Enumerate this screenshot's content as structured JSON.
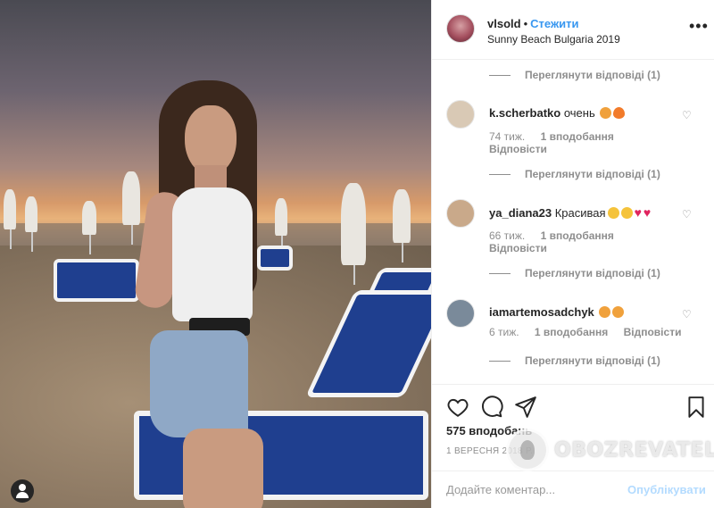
{
  "post": {
    "username": "vlsold",
    "separator": "•",
    "follow_label": "Стежити",
    "location": "Sunny Beach Bulgaria 2019",
    "more_label": "•••"
  },
  "comments": {
    "view_replies_label": "Переглянути відповіді (1)",
    "items": [
      {
        "username": "k.scherbatko",
        "text": "очень",
        "emojis": [
          "cat",
          "fire"
        ],
        "time": "74 тиж.",
        "likes": "1 вподобання",
        "reply_label": "Відповісти",
        "avatar_color": "#d9c9b5"
      },
      {
        "username": "ya_diana23",
        "text": "Красивая",
        "emojis": [
          "smile",
          "smile",
          "heart",
          "heart"
        ],
        "time": "66 тиж.",
        "likes": "1 вподобання",
        "reply_label": "Відповісти",
        "avatar_color": "#c9a98a"
      },
      {
        "username": "iamartemosadchyk",
        "text": "",
        "emojis": [
          "cat",
          "cat"
        ],
        "time": "6 тиж.",
        "likes": "1 вподобання",
        "reply_label": "Відповісти",
        "avatar_color": "#7a8a9a"
      }
    ]
  },
  "actions": {
    "likes_count": "575 вподобань",
    "date": "1 ВЕРЕСНЯ 2018 Р."
  },
  "comment_bar": {
    "placeholder": "Додайте коментар...",
    "publish_label": "Опублікувати"
  },
  "watermark": {
    "text": "OBOZREVATEL"
  },
  "icons": {
    "heart": "heart-icon",
    "comment": "comment-icon",
    "share": "share-icon",
    "bookmark": "bookmark-icon",
    "more": "more-options-icon"
  },
  "colors": {
    "accent": "#3897f0",
    "publish_disabled": "#b3dbff",
    "muted": "#8e8e8e",
    "border": "#efefef"
  }
}
